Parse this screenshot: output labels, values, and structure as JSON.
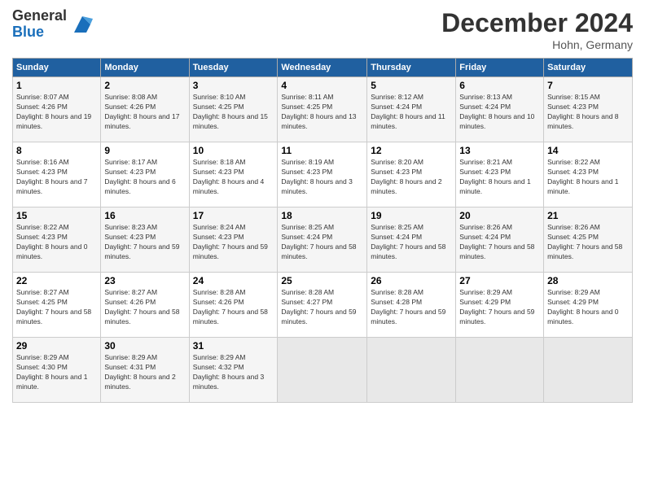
{
  "header": {
    "logo_line1": "General",
    "logo_line2": "Blue",
    "month": "December 2024",
    "location": "Hohn, Germany"
  },
  "days_of_week": [
    "Sunday",
    "Monday",
    "Tuesday",
    "Wednesday",
    "Thursday",
    "Friday",
    "Saturday"
  ],
  "weeks": [
    [
      {
        "day": 1,
        "info": "Sunrise: 8:07 AM\nSunset: 4:26 PM\nDaylight: 8 hours and 19 minutes."
      },
      {
        "day": 2,
        "info": "Sunrise: 8:08 AM\nSunset: 4:26 PM\nDaylight: 8 hours and 17 minutes."
      },
      {
        "day": 3,
        "info": "Sunrise: 8:10 AM\nSunset: 4:25 PM\nDaylight: 8 hours and 15 minutes."
      },
      {
        "day": 4,
        "info": "Sunrise: 8:11 AM\nSunset: 4:25 PM\nDaylight: 8 hours and 13 minutes."
      },
      {
        "day": 5,
        "info": "Sunrise: 8:12 AM\nSunset: 4:24 PM\nDaylight: 8 hours and 11 minutes."
      },
      {
        "day": 6,
        "info": "Sunrise: 8:13 AM\nSunset: 4:24 PM\nDaylight: 8 hours and 10 minutes."
      },
      {
        "day": 7,
        "info": "Sunrise: 8:15 AM\nSunset: 4:23 PM\nDaylight: 8 hours and 8 minutes."
      }
    ],
    [
      {
        "day": 8,
        "info": "Sunrise: 8:16 AM\nSunset: 4:23 PM\nDaylight: 8 hours and 7 minutes."
      },
      {
        "day": 9,
        "info": "Sunrise: 8:17 AM\nSunset: 4:23 PM\nDaylight: 8 hours and 6 minutes."
      },
      {
        "day": 10,
        "info": "Sunrise: 8:18 AM\nSunset: 4:23 PM\nDaylight: 8 hours and 4 minutes."
      },
      {
        "day": 11,
        "info": "Sunrise: 8:19 AM\nSunset: 4:23 PM\nDaylight: 8 hours and 3 minutes."
      },
      {
        "day": 12,
        "info": "Sunrise: 8:20 AM\nSunset: 4:23 PM\nDaylight: 8 hours and 2 minutes."
      },
      {
        "day": 13,
        "info": "Sunrise: 8:21 AM\nSunset: 4:23 PM\nDaylight: 8 hours and 1 minute."
      },
      {
        "day": 14,
        "info": "Sunrise: 8:22 AM\nSunset: 4:23 PM\nDaylight: 8 hours and 1 minute."
      }
    ],
    [
      {
        "day": 15,
        "info": "Sunrise: 8:22 AM\nSunset: 4:23 PM\nDaylight: 8 hours and 0 minutes."
      },
      {
        "day": 16,
        "info": "Sunrise: 8:23 AM\nSunset: 4:23 PM\nDaylight: 7 hours and 59 minutes."
      },
      {
        "day": 17,
        "info": "Sunrise: 8:24 AM\nSunset: 4:23 PM\nDaylight: 7 hours and 59 minutes."
      },
      {
        "day": 18,
        "info": "Sunrise: 8:25 AM\nSunset: 4:24 PM\nDaylight: 7 hours and 58 minutes."
      },
      {
        "day": 19,
        "info": "Sunrise: 8:25 AM\nSunset: 4:24 PM\nDaylight: 7 hours and 58 minutes."
      },
      {
        "day": 20,
        "info": "Sunrise: 8:26 AM\nSunset: 4:24 PM\nDaylight: 7 hours and 58 minutes."
      },
      {
        "day": 21,
        "info": "Sunrise: 8:26 AM\nSunset: 4:25 PM\nDaylight: 7 hours and 58 minutes."
      }
    ],
    [
      {
        "day": 22,
        "info": "Sunrise: 8:27 AM\nSunset: 4:25 PM\nDaylight: 7 hours and 58 minutes."
      },
      {
        "day": 23,
        "info": "Sunrise: 8:27 AM\nSunset: 4:26 PM\nDaylight: 7 hours and 58 minutes."
      },
      {
        "day": 24,
        "info": "Sunrise: 8:28 AM\nSunset: 4:26 PM\nDaylight: 7 hours and 58 minutes."
      },
      {
        "day": 25,
        "info": "Sunrise: 8:28 AM\nSunset: 4:27 PM\nDaylight: 7 hours and 59 minutes."
      },
      {
        "day": 26,
        "info": "Sunrise: 8:28 AM\nSunset: 4:28 PM\nDaylight: 7 hours and 59 minutes."
      },
      {
        "day": 27,
        "info": "Sunrise: 8:29 AM\nSunset: 4:29 PM\nDaylight: 7 hours and 59 minutes."
      },
      {
        "day": 28,
        "info": "Sunrise: 8:29 AM\nSunset: 4:29 PM\nDaylight: 8 hours and 0 minutes."
      }
    ],
    [
      {
        "day": 29,
        "info": "Sunrise: 8:29 AM\nSunset: 4:30 PM\nDaylight: 8 hours and 1 minute."
      },
      {
        "day": 30,
        "info": "Sunrise: 8:29 AM\nSunset: 4:31 PM\nDaylight: 8 hours and 2 minutes."
      },
      {
        "day": 31,
        "info": "Sunrise: 8:29 AM\nSunset: 4:32 PM\nDaylight: 8 hours and 3 minutes."
      },
      null,
      null,
      null,
      null
    ]
  ]
}
